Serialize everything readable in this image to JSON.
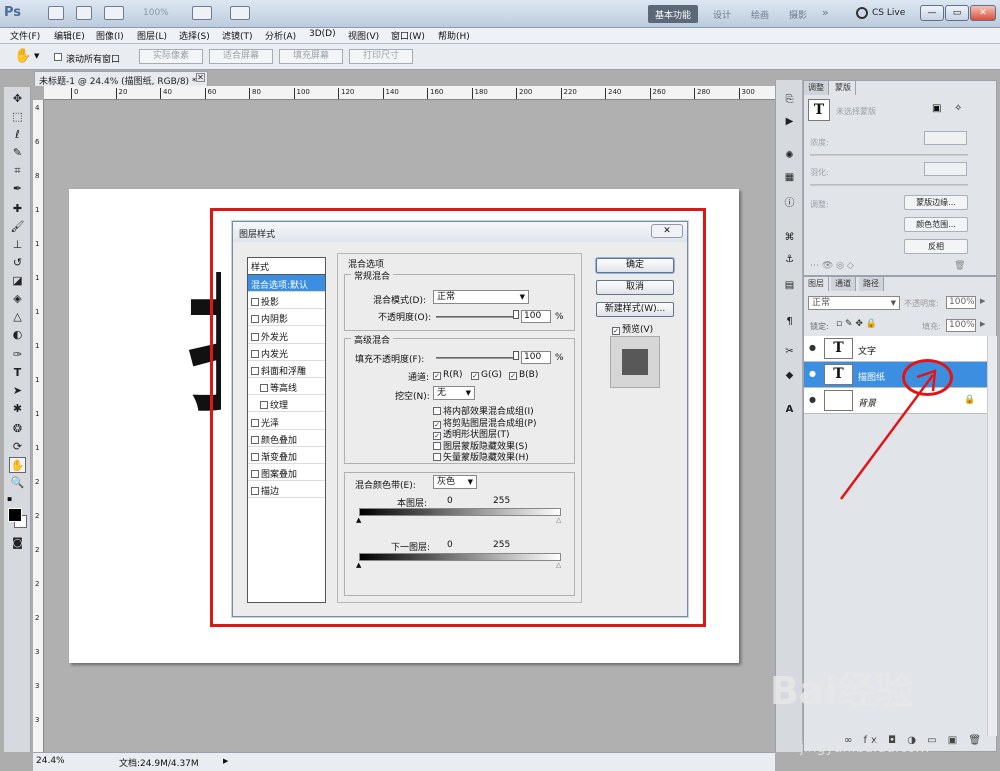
{
  "app": {
    "logo": "Ps",
    "zoom_pct": "100%"
  },
  "workspace": {
    "items": [
      "基本功能",
      "设计",
      "绘画",
      "摄影"
    ],
    "active": "基本功能",
    "more": "»",
    "cs_live": "CS Live"
  },
  "window_buttons": [
    "—",
    "▭",
    "✕"
  ],
  "menu": [
    "文件(F)",
    "编辑(E)",
    "图像(I)",
    "图层(L)",
    "选择(S)",
    "滤镜(T)",
    "分析(A)",
    "3D(D)",
    "视图(V)",
    "窗口(W)",
    "帮助(H)"
  ],
  "options": {
    "scroll_all": "滚动所有窗口",
    "actual_pixels": "实际像素",
    "fit_screen": "适合屏幕",
    "fill_screen": "填充屏幕",
    "print_size": "打印尺寸"
  },
  "document": {
    "tab_title": "未标题-1 @ 24.4% (描图纸, RGB/8) *",
    "ruler_marks": [
      "0",
      "20",
      "40",
      "60",
      "80",
      "100",
      "120",
      "140",
      "160",
      "180",
      "200",
      "220",
      "240",
      "260",
      "280",
      "300"
    ],
    "vruler_marks": [
      "4",
      "6",
      "8",
      "1",
      "1",
      "1",
      "1",
      "1",
      "1",
      "1",
      "1",
      "2",
      "2",
      "2",
      "2",
      "2",
      "3",
      "3",
      "3"
    ],
    "big_char": "扌"
  },
  "status": {
    "zoom": "24.4%",
    "doc_info": "文档:24.9M/4.37M"
  },
  "dialog": {
    "title": "图层样式",
    "close": "✕",
    "styles_header": "样式",
    "styles": [
      {
        "label": "混合选项:默认",
        "checkbox": false,
        "selected": true,
        "indent": false
      },
      {
        "label": "投影",
        "checkbox": true,
        "selected": false,
        "indent": false
      },
      {
        "label": "内阴影",
        "checkbox": true,
        "selected": false,
        "indent": false
      },
      {
        "label": "外发光",
        "checkbox": true,
        "selected": false,
        "indent": false
      },
      {
        "label": "内发光",
        "checkbox": true,
        "selected": false,
        "indent": false
      },
      {
        "label": "斜面和浮雕",
        "checkbox": true,
        "selected": false,
        "indent": false
      },
      {
        "label": "等高线",
        "checkbox": true,
        "selected": false,
        "indent": true
      },
      {
        "label": "纹理",
        "checkbox": true,
        "selected": false,
        "indent": true
      },
      {
        "label": "光泽",
        "checkbox": true,
        "selected": false,
        "indent": false
      },
      {
        "label": "颜色叠加",
        "checkbox": true,
        "selected": false,
        "indent": false
      },
      {
        "label": "渐变叠加",
        "checkbox": true,
        "selected": false,
        "indent": false
      },
      {
        "label": "图案叠加",
        "checkbox": true,
        "selected": false,
        "indent": false
      },
      {
        "label": "描边",
        "checkbox": true,
        "selected": false,
        "indent": false
      }
    ],
    "blend_options": "混合选项",
    "general_blend": "常规混合",
    "blend_mode_label": "混合模式(D):",
    "blend_mode_value": "正常",
    "opacity_label": "不透明度(O):",
    "opacity_value": "100",
    "pct": "%",
    "advanced_blend": "高级混合",
    "fill_opacity_label": "填充不透明度(F):",
    "fill_opacity_value": "100",
    "channels_label": "通道:",
    "channels": [
      "R(R)",
      "G(G)",
      "B(B)"
    ],
    "knockout_label": "挖空(N):",
    "knockout_value": "无",
    "adv_checks": [
      {
        "label": "将内部效果混合成组(I)",
        "checked": false
      },
      {
        "label": "将剪贴图层混合成组(P)",
        "checked": true
      },
      {
        "label": "透明形状图层(T)",
        "checked": true
      },
      {
        "label": "图层蒙版隐藏效果(S)",
        "checked": false
      },
      {
        "label": "矢量蒙版隐藏效果(H)",
        "checked": false
      }
    ],
    "blend_if_label": "混合颜色带(E):",
    "blend_if_value": "灰色",
    "this_layer": "本图层:",
    "underlying_layer": "下一图层:",
    "range_min": "0",
    "range_max": "255",
    "ok": "确定",
    "cancel": "取消",
    "new_style": "新建样式(W)...",
    "preview": "预览(V)"
  },
  "panels": {
    "mask_tabs": [
      "调整",
      "蒙版"
    ],
    "no_mask": "未选择蒙版",
    "density": "浓度:",
    "feather": "羽化:",
    "refine_label": "调整:",
    "mask_edge": "蒙版边缘...",
    "color_range": "颜色范围...",
    "invert": "反相",
    "layer_tabs": [
      "图层",
      "通道",
      "路径"
    ],
    "layer_blend": "正常",
    "layer_opacity_label": "不透明度:",
    "layer_opacity": "100%",
    "lock_label": "锁定:",
    "fill_label": "填充:",
    "fill_value": "100%",
    "layers": [
      {
        "name": "文字",
        "thumb": "T",
        "selected": false
      },
      {
        "name": "描图纸",
        "thumb": "T",
        "selected": true
      },
      {
        "name": "背景",
        "thumb": "",
        "selected": false
      }
    ]
  },
  "watermark": {
    "brand": "Bai经验",
    "url": "jingyan.baidu.com"
  },
  "colors": {
    "annotation_red": "#e01515",
    "selection_blue": "#3c8fe0"
  }
}
